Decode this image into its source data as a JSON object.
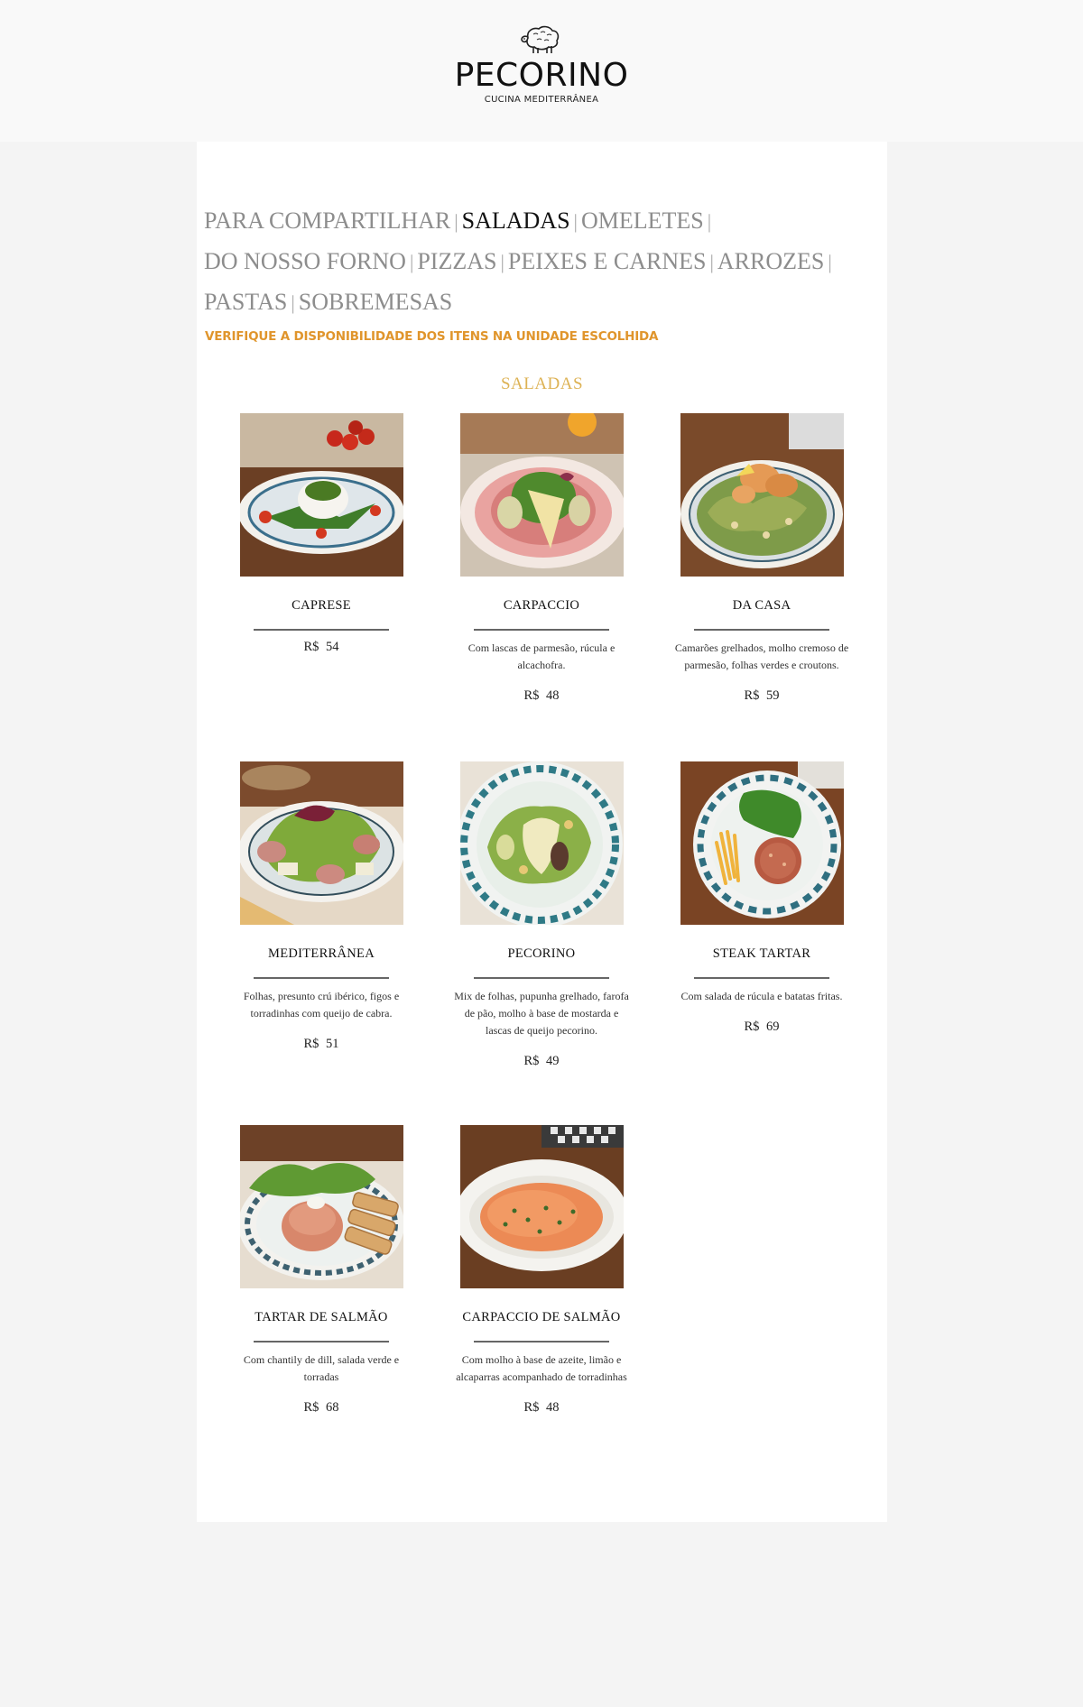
{
  "brand": {
    "name": "PECORINO",
    "tagline": "CUCINA MEDITERRÂNEA",
    "logo_icon": "sheep-icon"
  },
  "nav": {
    "items": [
      {
        "label": "PARA COMPARTILHAR",
        "active": false
      },
      {
        "label": "SALADAS",
        "active": true
      },
      {
        "label": "OMELETES",
        "active": false
      },
      {
        "label": "DO NOSSO FORNO",
        "active": false
      },
      {
        "label": "PIZZAS",
        "active": false
      },
      {
        "label": "PEIXES E CARNES",
        "active": false
      },
      {
        "label": "ARROZES",
        "active": false
      },
      {
        "label": "PASTAS",
        "active": false
      },
      {
        "label": "SOBREMESAS",
        "active": false
      }
    ],
    "separator": "|"
  },
  "notice": "VERIFIQUE A DISPONIBILIDADE DOS ITENS NA UNIDADE ESCOLHIDA",
  "section_title": "SALADAS",
  "menu_items": [
    {
      "name": "CAPRESE",
      "desc": "",
      "currency": "R$",
      "price": "54"
    },
    {
      "name": "CARPACCIO",
      "desc": "Com lascas de parmesão, rúcula e alcachofra.",
      "currency": "R$",
      "price": "48"
    },
    {
      "name": "DA CASA",
      "desc": "Camarões grelhados, molho cremoso de parmesão, folhas verdes e croutons.",
      "currency": "R$",
      "price": "59"
    },
    {
      "name": "MEDITERRÂNEA",
      "desc": "Folhas, presunto crú ibérico, figos e torradinhas com queijo de cabra.",
      "currency": "R$",
      "price": "51"
    },
    {
      "name": "PECORINO",
      "desc": "Mix de folhas, pupunha grelhado, farofa de pão, molho à base de mostarda e lascas de queijo pecorino.",
      "currency": "R$",
      "price": "49"
    },
    {
      "name": "STEAK TARTAR",
      "desc": "Com salada de rúcula e batatas fritas.",
      "currency": "R$",
      "price": "69"
    },
    {
      "name": "TARTAR DE SALMÃO",
      "desc": "Com chantily de dill, salada verde e torradas",
      "currency": "R$",
      "price": "68"
    },
    {
      "name": "CARPACCIO DE SALMÃO",
      "desc": "Com molho à base de azeite, limão e alcaparras acompanhado de torradinhas",
      "currency": "R$",
      "price": "48"
    }
  ],
  "colors": {
    "accent_orange": "#e0952c",
    "section_gold": "#ddb254",
    "nav_inactive": "#8d8d8d",
    "nav_active": "#111111",
    "page_bg": "#f4f4f4"
  }
}
